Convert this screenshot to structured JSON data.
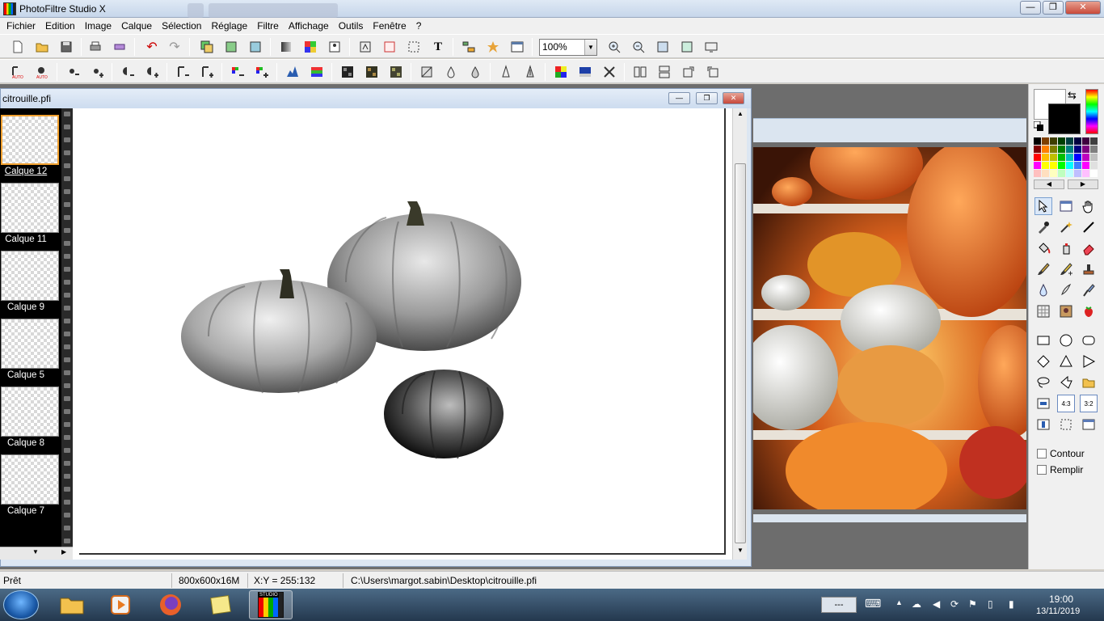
{
  "app": {
    "title": "PhotoFiltre Studio X",
    "window_buttons": [
      "—",
      "❐",
      "✕"
    ]
  },
  "menu": [
    "Fichier",
    "Edition",
    "Image",
    "Calque",
    "Sélection",
    "Réglage",
    "Filtre",
    "Affichage",
    "Outils",
    "Fenêtre",
    "?"
  ],
  "toolbar": {
    "zoom_value": "100%",
    "text_tool_glyph": "T"
  },
  "document": {
    "title": "citrouille.pfi"
  },
  "layers": [
    {
      "label": "Calque 12",
      "selected": true
    },
    {
      "label": "Calque 11",
      "selected": false
    },
    {
      "label": "Calque 9",
      "selected": false
    },
    {
      "label": "Calque 5",
      "selected": false
    },
    {
      "label": "Calque 8",
      "selected": false
    },
    {
      "label": "Calque 7",
      "selected": false
    }
  ],
  "tools_panel": {
    "contour_label": "Contour",
    "remplir_label": "Remplir",
    "ratio_43": "4:3",
    "ratio_32": "3:2",
    "palette": [
      "#000000",
      "#7f3f00",
      "#3f3f00",
      "#003f00",
      "#003f3f",
      "#00003f",
      "#3f003f",
      "#3f3f3f",
      "#7f0000",
      "#ff7f00",
      "#7f7f00",
      "#007f00",
      "#007f7f",
      "#00007f",
      "#7f007f",
      "#7f7f7f",
      "#ff0000",
      "#ffbf00",
      "#bfbf00",
      "#00bf00",
      "#00bfbf",
      "#0000ff",
      "#bf00bf",
      "#bfbfbf",
      "#ff00ff",
      "#ffff00",
      "#ffff00",
      "#00ff00",
      "#00ffff",
      "#3f7fff",
      "#ff00ff",
      "#e0e0e0",
      "#ffbfbf",
      "#ffdfbf",
      "#ffffbf",
      "#bfffbf",
      "#bfffff",
      "#bfbfff",
      "#ffbfff",
      "#ffffff"
    ]
  },
  "status": {
    "state": "Prêt",
    "size": "800x600x16M",
    "coords": "X:Y = 255:132",
    "path": "C:\\Users\\margot.sabin\\Desktop\\citrouille.pfi"
  },
  "taskbar": {
    "time": "19:00",
    "date": "13/11/2019",
    "lang": "---",
    "studio_badge": "STUDIO"
  }
}
